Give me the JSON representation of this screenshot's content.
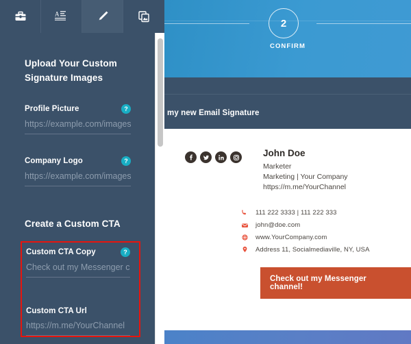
{
  "left_panel": {
    "toolbar": {
      "items": [
        {
          "name": "toolbox-icon",
          "label": "Toolbox",
          "active": false
        },
        {
          "name": "text-format-icon",
          "label": "Text Formatting",
          "active": false
        },
        {
          "name": "brush-icon",
          "label": "Design",
          "active": true
        },
        {
          "name": "duplicate-images-icon",
          "label": "Images",
          "active": false
        }
      ]
    },
    "upload_section": {
      "heading": "Upload Your Custom Signature Images",
      "fields": [
        {
          "label": "Profile Picture",
          "value": "https://example.com/images/n",
          "placeholder": "https://example.com/images/n",
          "help": "?",
          "has_help": true
        },
        {
          "label": "Company Logo",
          "value": "https://example.com/images/n",
          "placeholder": "https://example.com/images/n",
          "help": "?",
          "has_help": true
        }
      ]
    },
    "cta_section": {
      "heading": "Create a Custom CTA",
      "fields": [
        {
          "label": "Custom CTA Copy",
          "value": "Check out my Messenger chan",
          "placeholder": "Check out my Messenger chan",
          "help": "?",
          "has_help": true
        },
        {
          "label": "Custom CTA Url",
          "value": "https://m.me/YourChannel",
          "placeholder": "https://m.me/YourChannel",
          "help": "",
          "has_help": false
        }
      ],
      "highlight_color": "#e8140d"
    },
    "scrollbar": {
      "name": "panel-scrollbar"
    },
    "colors": {
      "background": "#3b5169",
      "help_badge": "#18aec4",
      "label": "#ffffff",
      "input_text": "#8e9dae"
    }
  },
  "preview": {
    "stepper": {
      "step_number": "2",
      "step_label": "CONFIRM"
    },
    "mail": {
      "subject": "my new Email Signature"
    },
    "signature": {
      "socials": [
        {
          "icon": "facebook-icon",
          "label": "Facebook"
        },
        {
          "icon": "twitter-icon",
          "label": "Twitter"
        },
        {
          "icon": "linkedin-icon",
          "label": "LinkedIn"
        },
        {
          "icon": "instagram-icon",
          "label": "Instagram"
        }
      ],
      "name": "John Doe",
      "title": "Marketer",
      "company": "Marketing | Your Company",
      "link": "https://m.me/YourChannel",
      "contacts": [
        {
          "icon": "phone-icon",
          "text": "111 222 3333  |  111 222 333"
        },
        {
          "icon": "envelope-icon",
          "text": "john@doe.com"
        },
        {
          "icon": "globe-icon",
          "text": "www.YourCompany.com"
        },
        {
          "icon": "location-pin-icon",
          "text": "Address 11, Socialmediaville, NY, USA"
        }
      ],
      "cta_label": "Check out my Messenger channel!",
      "cta_color": "#c9502f"
    },
    "colors": {
      "header_blue_start": "#2e90c6",
      "header_blue_end": "#3f9ad3",
      "mail_header": "#3b5169",
      "footer_band_start": "#4b82c8",
      "footer_band_end": "#6079c4"
    }
  }
}
